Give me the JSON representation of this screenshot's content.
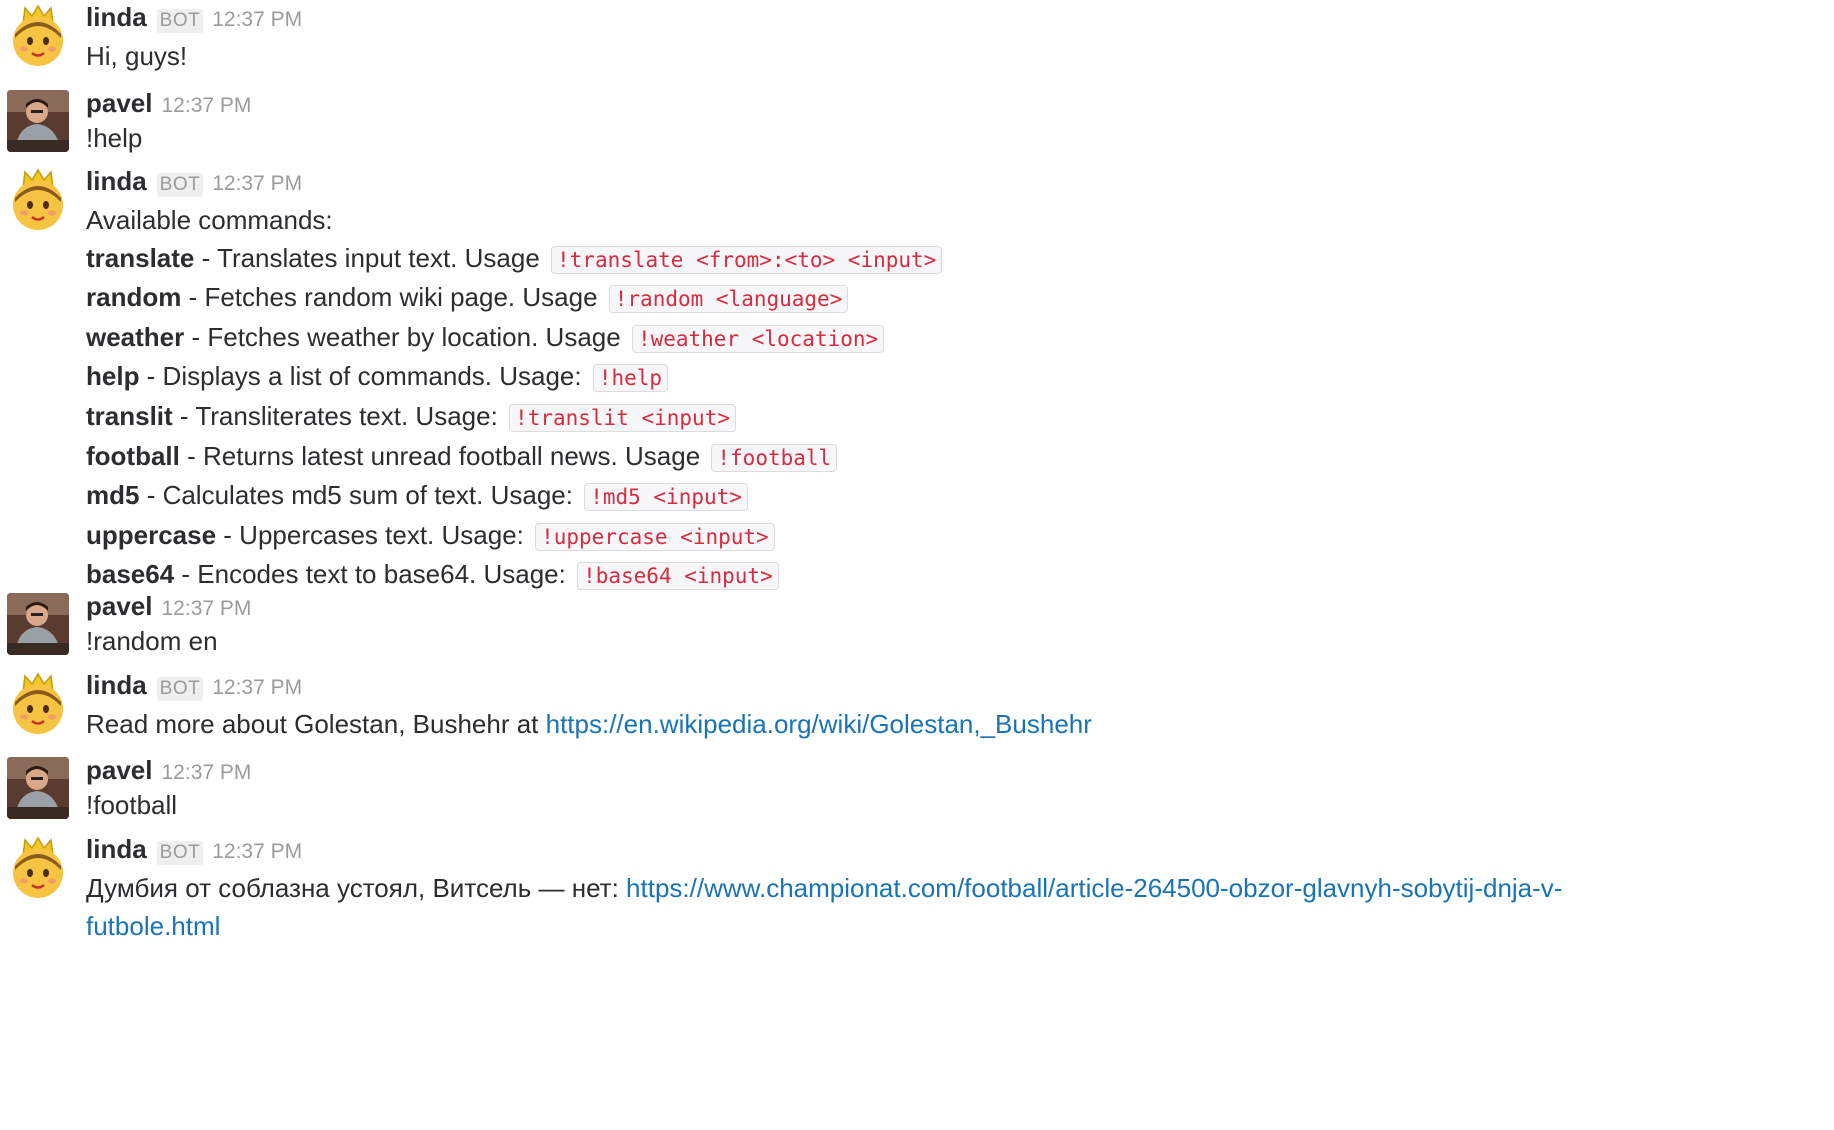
{
  "colors": {
    "link": "#1a73b5",
    "code_text": "#d72b3f",
    "code_bg": "#f7f7f9",
    "muted": "#9a9b9e",
    "text": "#2c2d30"
  },
  "icons": {
    "bot_avatar": "princess-emoji-avatar",
    "user_avatar": "user-photo-avatar"
  },
  "messages": [
    {
      "author": "linda",
      "badge": "BOT",
      "time": "12:37 PM",
      "text": "Hi, guys!"
    },
    {
      "author": "pavel",
      "time": "12:37 PM",
      "text": "!help"
    },
    {
      "author": "linda",
      "badge": "BOT",
      "time": "12:37 PM",
      "intro": "Available commands:",
      "commands": [
        {
          "name": "translate",
          "desc": " - Translates input text. Usage ",
          "usage": "!translate <from>:<to> <input>"
        },
        {
          "name": "random",
          "desc": " - Fetches random wiki page. Usage ",
          "usage": "!random <language>"
        },
        {
          "name": "weather",
          "desc": " - Fetches weather by location. Usage ",
          "usage": "!weather <location>"
        },
        {
          "name": "help",
          "desc": " - Displays a list of commands. Usage: ",
          "usage": "!help"
        },
        {
          "name": "translit",
          "desc": " - Transliterates text. Usage: ",
          "usage": "!translit <input>"
        },
        {
          "name": "football",
          "desc": " - Returns latest unread football news. Usage ",
          "usage": "!football"
        },
        {
          "name": "md5",
          "desc": " - Calculates md5 sum of text. Usage: ",
          "usage": "!md5 <input>"
        },
        {
          "name": "uppercase",
          "desc": " - Uppercases text. Usage: ",
          "usage": "!uppercase <input>"
        },
        {
          "name": "base64",
          "desc": " - Encodes text to base64. Usage: ",
          "usage": "!base64 <input>"
        }
      ]
    },
    {
      "author": "pavel",
      "time": "12:37 PM",
      "text": "!random en"
    },
    {
      "author": "linda",
      "badge": "BOT",
      "time": "12:37 PM",
      "text": "Read more about Golestan, Bushehr at ",
      "link": "https://en.wikipedia.org/wiki/Golestan,_Bushehr"
    },
    {
      "author": "pavel",
      "time": "12:37 PM",
      "text": "!football"
    },
    {
      "author": "linda",
      "badge": "BOT",
      "time": "12:37 PM",
      "text": "Думбия от соблазна устоял, Витсель — нет: ",
      "link": "https://www.championat.com/football/article-264500-obzor-glavnyh-sobytij-dnja-v-futbole.html"
    }
  ]
}
